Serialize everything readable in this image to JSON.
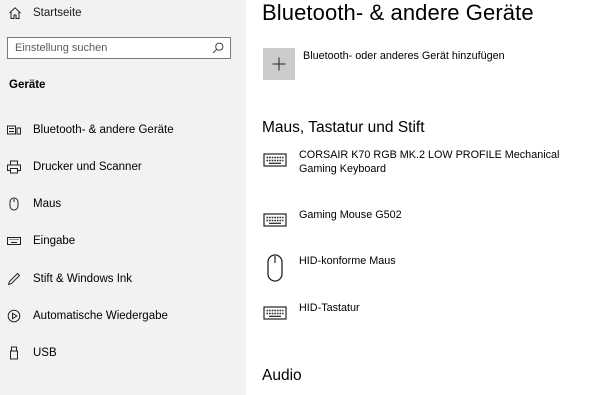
{
  "sidebar": {
    "home": {
      "label": "Startseite",
      "icon": "home-icon"
    },
    "search": {
      "placeholder": "Einstellung suchen",
      "value": "",
      "icon": "search-icon"
    },
    "section_label": "Geräte",
    "items": [
      {
        "label": "Bluetooth- & andere Geräte",
        "icon": "bluetooth-devices-icon",
        "selected": true
      },
      {
        "label": "Drucker und Scanner",
        "icon": "printer-icon"
      },
      {
        "label": "Maus",
        "icon": "mouse-icon"
      },
      {
        "label": "Eingabe",
        "icon": "keyboard-icon"
      },
      {
        "label": "Stift & Windows Ink",
        "icon": "pen-icon"
      },
      {
        "label": "Automatische Wiedergabe",
        "icon": "autoplay-icon"
      },
      {
        "label": "USB",
        "icon": "usb-icon"
      }
    ]
  },
  "main": {
    "title": "Bluetooth- & andere Geräte",
    "add_device": {
      "label": "Bluetooth- oder anderes Gerät hinzufügen",
      "icon": "plus-icon"
    },
    "groups": [
      {
        "heading": "Maus, Tastatur und Stift",
        "devices": [
          {
            "name": "CORSAIR K70 RGB MK.2 LOW PROFILE Mechanical Gaming Keyboard",
            "icon": "keyboard-icon"
          },
          {
            "name": "Gaming Mouse G502",
            "icon": "keyboard-icon"
          },
          {
            "name": "HID-konforme Maus",
            "icon": "mouse-icon"
          },
          {
            "name": "HID-Tastatur",
            "icon": "keyboard-icon"
          }
        ]
      },
      {
        "heading": "Audio",
        "devices": []
      }
    ]
  },
  "colors": {
    "sidebar_bg": "#f2f2f2",
    "content_bg": "#ffffff",
    "add_button_bg": "#cccccc",
    "text": "#000000"
  }
}
